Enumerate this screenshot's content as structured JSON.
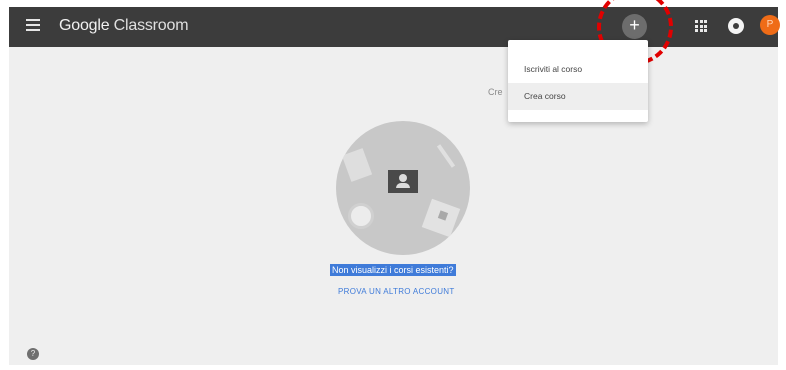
{
  "header": {
    "brand_part1": "Google",
    "brand_part2": "Classroom",
    "add_button": "+",
    "avatar_initial": "P"
  },
  "menu": {
    "items": [
      {
        "label": "Iscriviti al corso"
      },
      {
        "label": "Crea corso"
      }
    ]
  },
  "background": {
    "partial_label": "Cre"
  },
  "main": {
    "selected_text": "Non visualizzi i corsi esistenti?",
    "switch_account_link": "PROVA UN ALTRO ACCOUNT"
  },
  "footer": {
    "help_icon": "?"
  },
  "colors": {
    "topbar": "#3c3c3c",
    "accent_link": "#3f7bd9",
    "avatar": "#ef6c17",
    "annotation": "#e10000"
  },
  "icons": {
    "menu": "hamburger-menu-icon",
    "add": "plus-icon",
    "apps": "apps-grid-icon",
    "notifications": "notifications-icon",
    "help": "help-icon"
  }
}
